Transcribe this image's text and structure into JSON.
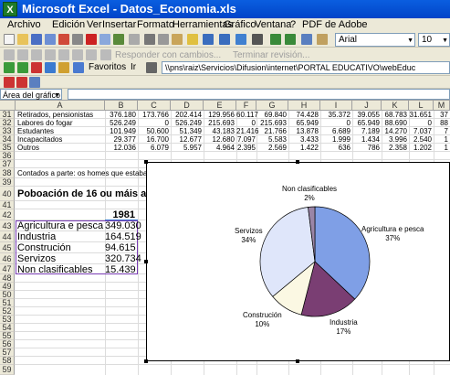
{
  "window": {
    "title": "Microsoft Excel - Datos_Economia.xls",
    "app_icon": "excel-icon"
  },
  "menu": [
    "Archivo",
    "Edición",
    "Ver",
    "Insertar",
    "Formato",
    "Herramientas",
    "Gráfico",
    "Ventana",
    "?",
    "PDF de Adobe"
  ],
  "toolbar": {
    "font": "Arial",
    "font_size": "10",
    "reviewing_reply": "Responder con cambios...",
    "reviewing_end": "Terminar revisión...",
    "favorites": "Favoritos",
    "go": "Ir",
    "address": "\\\\pns\\raiz\\Servicios\\Difusion\\internet\\PORTAL EDUCATIVO\\webEduc"
  },
  "namebox": "Área del gráfico",
  "columns": [
    "A",
    "B",
    "C",
    "D",
    "E",
    "F",
    "G",
    "H",
    "I",
    "J",
    "K",
    "L",
    "M"
  ],
  "rows": [
    "31",
    "32",
    "33",
    "34",
    "35",
    "36",
    "37",
    "38",
    "39",
    "40",
    "41",
    "42",
    "43",
    "44",
    "45",
    "46",
    "47",
    "48",
    "49",
    "50",
    "51",
    "52",
    "53",
    "54",
    "55",
    "56",
    "57",
    "58",
    "59"
  ],
  "upper_table": [
    {
      "label": "Retirados, pensionistas",
      "values": [
        "376.180",
        "173.766",
        "202.414",
        "129.956",
        "60.117",
        "69.840",
        "74.428",
        "35.372",
        "39.055",
        "68.783",
        "31.651",
        "37"
      ]
    },
    {
      "label": "Labores do fogar",
      "values": [
        "526.249",
        "0",
        "526.249",
        "215.693",
        "0",
        "215.693",
        "65.949",
        "0",
        "65.949",
        "88.690",
        "0",
        "88"
      ]
    },
    {
      "label": "Estudantes",
      "values": [
        "101.949",
        "50.600",
        "51.349",
        "43.183",
        "21.416",
        "21.766",
        "13.878",
        "6.689",
        "7.189",
        "14.270",
        "7.037",
        "7"
      ]
    },
    {
      "label": "Incapacitados",
      "values": [
        "29.377",
        "16.700",
        "12.677",
        "12.680",
        "7.097",
        "5.583",
        "3.433",
        "1.999",
        "1.434",
        "3.996",
        "2.540",
        "1"
      ]
    },
    {
      "label": "Outros",
      "values": [
        "12.036",
        "6.079",
        "5.957",
        "4.964",
        "2.395",
        "2.569",
        "1.422",
        "636",
        "786",
        "2.358",
        "1.202",
        "1"
      ]
    }
  ],
  "note": "Contados a parte: os homes que estaban cumpri",
  "section_title": "Poboación de 16 ou máis anos",
  "year_header": "1981",
  "sector_table": [
    {
      "label": "Agricultura e pesca",
      "value": "349.030"
    },
    {
      "label": "Industria",
      "value": "164.519"
    },
    {
      "label": "Construción",
      "value": "94.615"
    },
    {
      "label": "Servizos",
      "value": "320.734"
    },
    {
      "label": "Non clasificables",
      "value": "15.439"
    }
  ],
  "chart_data": {
    "type": "pie",
    "categories": [
      "Agricultura e pesca",
      "Industria",
      "Construción",
      "Servizos",
      "Non clasificables"
    ],
    "values": [
      37,
      17,
      10,
      34,
      2
    ],
    "labels": [
      {
        "name": "Agricultura e pesca",
        "pct": "37%"
      },
      {
        "name": "Industria",
        "pct": "17%"
      },
      {
        "name": "Construción",
        "pct": "10%"
      },
      {
        "name": "Servizos",
        "pct": "34%"
      },
      {
        "name": "Non clasificables",
        "pct": "2%"
      }
    ],
    "colors": [
      "#7f9fe6",
      "#7a3e73",
      "#fbf8e3",
      "#dfe6fa",
      "#9a85a6"
    ]
  }
}
